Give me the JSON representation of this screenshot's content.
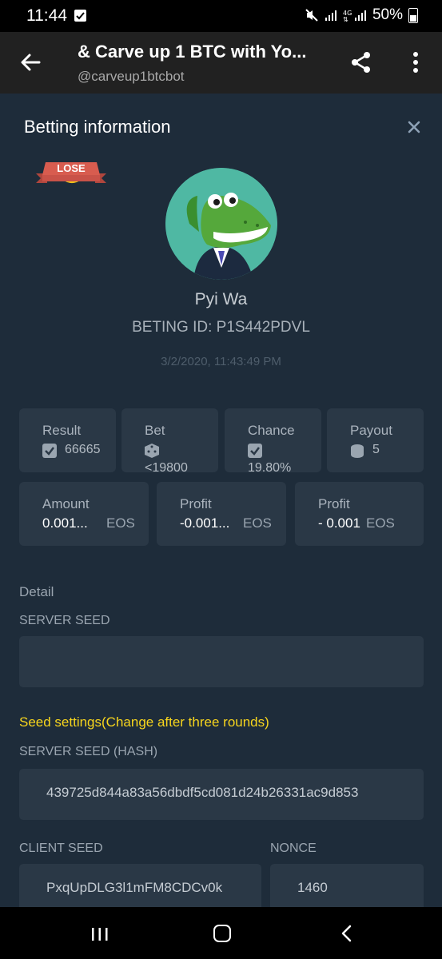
{
  "status_bar": {
    "time": "11:44",
    "battery": "50%"
  },
  "app_bar": {
    "title": "& Carve up 1 BTC with Yo...",
    "subtitle": "@carveup1btcbot"
  },
  "panel": {
    "title": "Betting information",
    "badge": "LOSE",
    "user_name": "Pyi Wa",
    "bet_id": "BETING ID: P1S442PDVL",
    "timestamp": "3/2/2020, 11:43:49 PM"
  },
  "stats": {
    "result": {
      "label": "Result",
      "value": "66665"
    },
    "bet": {
      "label": "Bet",
      "value": "<19800"
    },
    "chance": {
      "label": "Chance",
      "value": "19.80%"
    },
    "payout": {
      "label": "Payout",
      "value": "5"
    }
  },
  "amounts": {
    "amount": {
      "label": "Amount",
      "value": "0.001...",
      "unit": "EOS"
    },
    "profit1": {
      "label": "Profit",
      "value": "-0.001...",
      "unit": "EOS"
    },
    "profit2": {
      "label": "Profit",
      "value": "- 0.001",
      "unit": "EOS"
    }
  },
  "detail": {
    "title": "Detail",
    "server_seed_label": "SERVER SEED",
    "server_seed_value": "",
    "seed_settings": "Seed settings(Change after three rounds)",
    "server_seed_hash_label": "SERVER SEED (HASH)",
    "server_seed_hash_value": "439725d844a83a56dbdf5cd081d24b26331ac9d853",
    "client_seed_label": "CLIENT SEED",
    "client_seed_value": "PxqUpDLG3l1mFM8CDCv0k",
    "nonce_label": "NONCE",
    "nonce_value": "1460"
  },
  "colors": {
    "background": "#1e2c3a",
    "card": "#2a3846",
    "accent_yellow": "#f7d51d"
  },
  "icons": [
    "back-arrow-icon",
    "share-icon",
    "more-vert-icon",
    "close-icon",
    "dice-icon",
    "coin-icon"
  ]
}
